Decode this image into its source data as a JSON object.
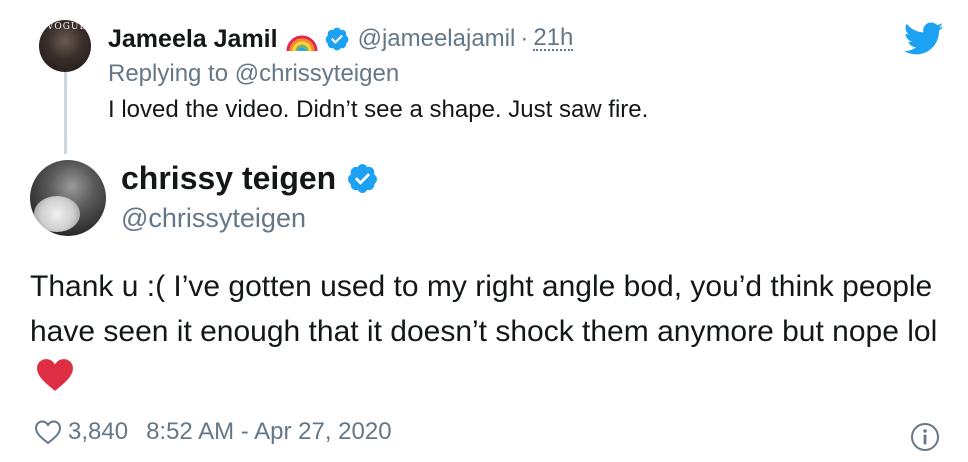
{
  "reply_tweet": {
    "avatar_text": "VOGUE",
    "display_name": "Jameela Jamil",
    "rainbow_icon": "rainbow-emoji",
    "verified_icon": "verified-badge-icon",
    "handle": "@jameelajamil",
    "separator": "·",
    "time": "21h",
    "replying_to": "Replying to @chrissyteigen",
    "text": "I loved the video. Didn’t see a shape. Just saw fire."
  },
  "main_tweet": {
    "display_name": "chrissy teigen",
    "verified_icon": "verified-badge-icon",
    "handle": "@chrissyteigen",
    "text": "Thank u :( I’ve gotten used to my right angle bod, you’d think people have seen it enough that it doesn’t shock them anymore but nope lol",
    "emoji": "red-heart-emoji",
    "like_count": "3,840",
    "timestamp": "8:52 AM - Apr 27, 2020"
  },
  "icons": {
    "logo": "twitter-bird-icon",
    "like": "heart-outline-icon",
    "info": "info-icon"
  },
  "colors": {
    "twitter_blue": "#1da1f2",
    "secondary_text": "#657786",
    "primary_text": "#14171a",
    "thread_line": "#ccd6dd",
    "heart_red": "#e0245e"
  }
}
